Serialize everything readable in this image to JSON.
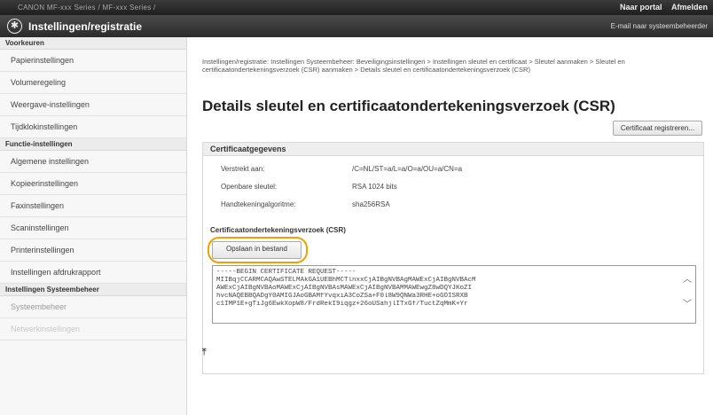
{
  "topbar": {
    "device": "CANON   MF-xxx Series / MF-xxx Series /",
    "portal": "Naar portal",
    "logout": "Afmelden"
  },
  "titlebar": {
    "title": "Instellingen/registratie",
    "mail": "E-mail naar systeembeheerder"
  },
  "sidebar": {
    "group1": "Voorkeuren",
    "items1": [
      "Papierinstellingen",
      "Volumeregeling",
      "Weergave-instellingen",
      "Tijdklokinstellingen"
    ],
    "group2": "Functie-instellingen",
    "items2": [
      "Algemene instellingen",
      "Kopieerinstellingen",
      "Faxinstellingen",
      "Scaninstellingen",
      "Printerinstellingen",
      "Instellingen afdrukrapport"
    ],
    "group3": "Instellingen Systeembeheer",
    "items3": [
      "Systeembeheer",
      "Netwerkinstellingen"
    ]
  },
  "main": {
    "breadcrumb": "Instellingen/registratie: Instellingen Systeembeheer: Beveiligingsinstellingen > Instellingen sleutel en certificaat > Sleutel aanmaken > Sleutel en certificaatondertekeningsverzoek (CSR) aanmaken > Details sleutel en certificaatondertekeningsverzoek (CSR)",
    "title": "Details sleutel en certificaatondertekeningsverzoek (CSR)",
    "register_button": "Certificaat registreren...",
    "section_title": "Certificaatgegevens",
    "rows": [
      {
        "label": "Verstrekt aan:",
        "value": "/C=NL/ST=a/L=a/O=a/OU=a/CN=a"
      },
      {
        "label": "Openbare sleutel:",
        "value": "RSA 1024 bits"
      },
      {
        "label": "Handtekeningalgoritme:",
        "value": "sha256RSA"
      }
    ],
    "csr_label": "Certificaatondertekeningsverzoek (CSR)",
    "save_button": "Opslaan in bestand",
    "csr_lines": [
      "-----BEGIN CERTIFICATE REQUEST-----",
      "MIIBqjCCARMCAQAwSTELMAkGA1UEBhMCTlnxxCjAIBgNVBAgMAWExCjAIBgNVBAcM",
      "AWExCjAIBgNVBAoMAWExCjAIBgNVBAsMAWExCjAIBgNVBAMMAWEwgZ8wDQYJKoZI",
      "hvcNAQEBBQADgY0AMIGJAoGBAMfYvqxiA3CoZSa+F0l8W9QNWa3RHE+oGOISRXB",
      "c1IMP1E+gTiJg6EwkXopW8/FrdRekI9iqgz+26oUSahjlITxGf/TuctZqMmK+Yr"
    ],
    "colors": {
      "highlight": "#f0a000"
    }
  }
}
